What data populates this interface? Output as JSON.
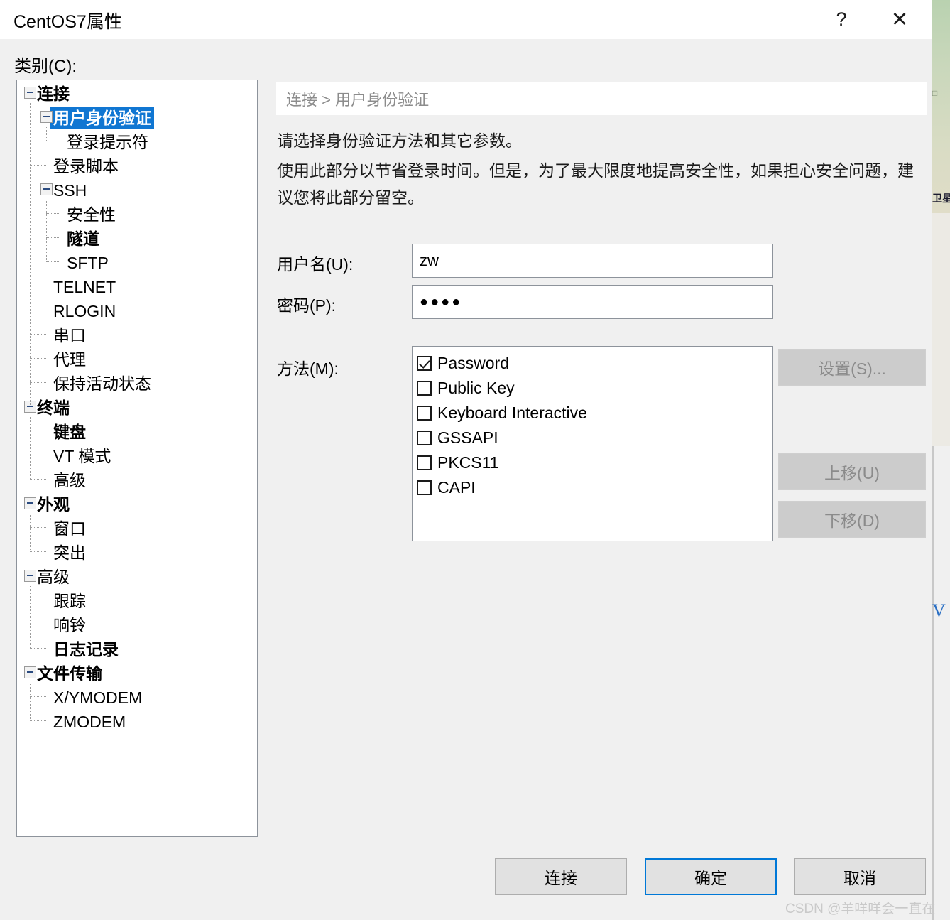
{
  "window": {
    "title": "CentOS7属性",
    "help_icon": "?",
    "close_icon": "✕"
  },
  "category": {
    "label": "类别(C):",
    "tree": [
      {
        "label": "连接",
        "depth": 0,
        "expander": true,
        "bold": true,
        "selected": false
      },
      {
        "label": "用户身份验证",
        "depth": 1,
        "expander": true,
        "bold": false,
        "selected": true
      },
      {
        "label": "登录提示符",
        "depth": 2,
        "expander": false,
        "bold": false,
        "selected": false
      },
      {
        "label": "登录脚本",
        "depth": 1,
        "expander": false,
        "bold": false,
        "selected": false
      },
      {
        "label": "SSH",
        "depth": 1,
        "expander": true,
        "bold": false,
        "selected": false
      },
      {
        "label": "安全性",
        "depth": 2,
        "expander": false,
        "bold": false,
        "selected": false
      },
      {
        "label": "隧道",
        "depth": 2,
        "expander": false,
        "bold": true,
        "selected": false
      },
      {
        "label": "SFTP",
        "depth": 2,
        "expander": false,
        "bold": false,
        "selected": false
      },
      {
        "label": "TELNET",
        "depth": 1,
        "expander": false,
        "bold": false,
        "selected": false
      },
      {
        "label": "RLOGIN",
        "depth": 1,
        "expander": false,
        "bold": false,
        "selected": false
      },
      {
        "label": "串口",
        "depth": 1,
        "expander": false,
        "bold": false,
        "selected": false
      },
      {
        "label": "代理",
        "depth": 1,
        "expander": false,
        "bold": false,
        "selected": false
      },
      {
        "label": "保持活动状态",
        "depth": 1,
        "expander": false,
        "bold": false,
        "selected": false
      },
      {
        "label": "终端",
        "depth": 0,
        "expander": true,
        "bold": true,
        "selected": false
      },
      {
        "label": "键盘",
        "depth": 1,
        "expander": false,
        "bold": true,
        "selected": false
      },
      {
        "label": "VT 模式",
        "depth": 1,
        "expander": false,
        "bold": false,
        "selected": false
      },
      {
        "label": "高级",
        "depth": 1,
        "expander": false,
        "bold": false,
        "selected": false
      },
      {
        "label": "外观",
        "depth": 0,
        "expander": true,
        "bold": true,
        "selected": false
      },
      {
        "label": "窗口",
        "depth": 1,
        "expander": false,
        "bold": false,
        "selected": false
      },
      {
        "label": "突出",
        "depth": 1,
        "expander": false,
        "bold": false,
        "selected": false
      },
      {
        "label": "高级",
        "depth": 0,
        "expander": true,
        "bold": false,
        "selected": false
      },
      {
        "label": "跟踪",
        "depth": 1,
        "expander": false,
        "bold": false,
        "selected": false
      },
      {
        "label": "响铃",
        "depth": 1,
        "expander": false,
        "bold": false,
        "selected": false
      },
      {
        "label": "日志记录",
        "depth": 1,
        "expander": false,
        "bold": true,
        "selected": false
      },
      {
        "label": "文件传输",
        "depth": 0,
        "expander": true,
        "bold": true,
        "selected": false
      },
      {
        "label": "X/YMODEM",
        "depth": 1,
        "expander": false,
        "bold": false,
        "selected": false
      },
      {
        "label": "ZMODEM",
        "depth": 1,
        "expander": false,
        "bold": false,
        "selected": false
      }
    ]
  },
  "content": {
    "breadcrumb": "连接 > 用户身份验证",
    "description_1": "请选择身份验证方法和其它参数。",
    "description_2": "使用此部分以节省登录时间。但是，为了最大限度地提高安全性，如果担心安全问题，建议您将此部分留空。",
    "username": {
      "label": "用户名(U):",
      "value": "zw"
    },
    "password": {
      "label": "密码(P):",
      "value": "●●●●"
    },
    "method": {
      "label": "方法(M):",
      "items": [
        {
          "label": "Password",
          "checked": true
        },
        {
          "label": "Public Key",
          "checked": false
        },
        {
          "label": "Keyboard Interactive",
          "checked": false
        },
        {
          "label": "GSSAPI",
          "checked": false
        },
        {
          "label": "PKCS11",
          "checked": false
        },
        {
          "label": "CAPI",
          "checked": false
        }
      ]
    },
    "side_buttons": {
      "setup": "设置(S)...",
      "move_up": "上移(U)",
      "move_down": "下移(D)"
    }
  },
  "footer": {
    "connect": "连接",
    "ok": "确定",
    "cancel": "取消"
  },
  "watermark": "CSDN @羊咩咩会一直在",
  "background_window": {
    "fragment_a": "□",
    "fragment_b": "卫星",
    "fragment_v": "V"
  },
  "colors": {
    "selection_blue": "#1076d2",
    "focus_blue": "#0078d7",
    "dialog_bg": "#f0f0f0",
    "field_border": "#8d939b",
    "disabled_btn": "#cccccc",
    "disabled_text": "#8b8b8b"
  }
}
